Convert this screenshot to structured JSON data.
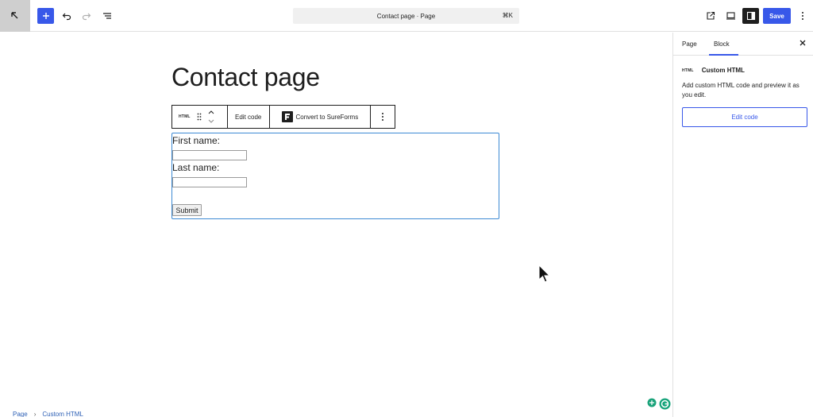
{
  "topbar": {
    "command_center_title": "Contact page · Page",
    "command_shortcut": "⌘K",
    "save_label": "Save"
  },
  "canvas": {
    "page_title": "Contact page",
    "block_toolbar": {
      "block_type_label": "HTML",
      "edit_code_label": "Edit code",
      "convert_label": "Convert to SureForms"
    },
    "form": {
      "first_name_label": "First name:",
      "first_name_value": "",
      "last_name_label": "Last name:",
      "last_name_value": "",
      "submit_label": "Submit"
    },
    "breadcrumb": [
      "Page",
      "Custom HTML"
    ]
  },
  "sidebar": {
    "tabs": [
      {
        "label": "Page",
        "active": false
      },
      {
        "label": "Block",
        "active": true
      }
    ],
    "block_icon_label": "HTML",
    "block_title": "Custom HTML",
    "block_description": "Add custom HTML code and preview it as you edit.",
    "edit_code_button": "Edit code"
  },
  "colors": {
    "accent": "#3858e9",
    "selection_border": "#3d8ad4",
    "dark": "#1e1e1e"
  },
  "icons": [
    "wordpress-back-icon",
    "plus-icon",
    "undo-icon",
    "redo-icon",
    "list-view-icon",
    "external-link-icon",
    "desktop-preview-icon",
    "settings-sidebar-icon",
    "more-vertical-icon",
    "drag-handle-icon",
    "move-up-icon",
    "move-down-icon",
    "sureforms-icon",
    "close-icon",
    "grammarly-icon",
    "mouse-pointer-icon"
  ]
}
